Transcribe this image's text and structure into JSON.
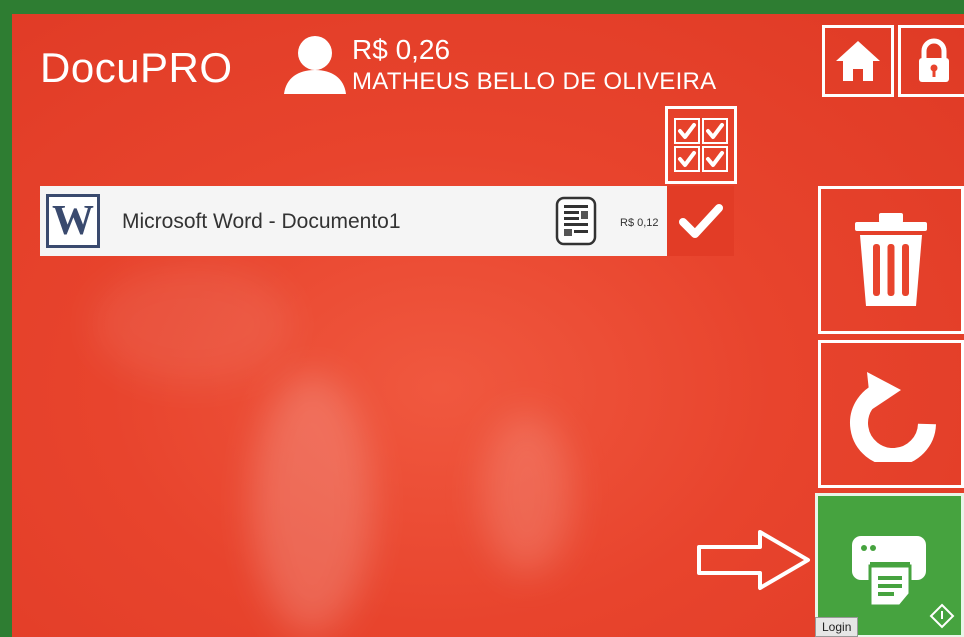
{
  "app": {
    "brand": "DocuPRO"
  },
  "user": {
    "balance": "R$ 0,26",
    "name": "MATHEUS BELLO DE OLIVEIRA"
  },
  "toolbar": {
    "home_icon": "home-icon",
    "lock_icon": "lock-icon",
    "select_all_icon": "select-all-icon"
  },
  "documents": [
    {
      "app_letter": "W",
      "title": "Microsoft Word - Documento1",
      "price": "R$ 0,12",
      "selected": true
    }
  ],
  "actions": {
    "trash_icon": "trash-icon",
    "refresh_icon": "refresh-icon",
    "print_icon": "printer-icon",
    "print_tooltip": "Login"
  },
  "colors": {
    "background": "#e8442d",
    "print_button": "#46a33f",
    "row_background": "#f5f5f5",
    "word_blue": "#3a4a6e"
  }
}
